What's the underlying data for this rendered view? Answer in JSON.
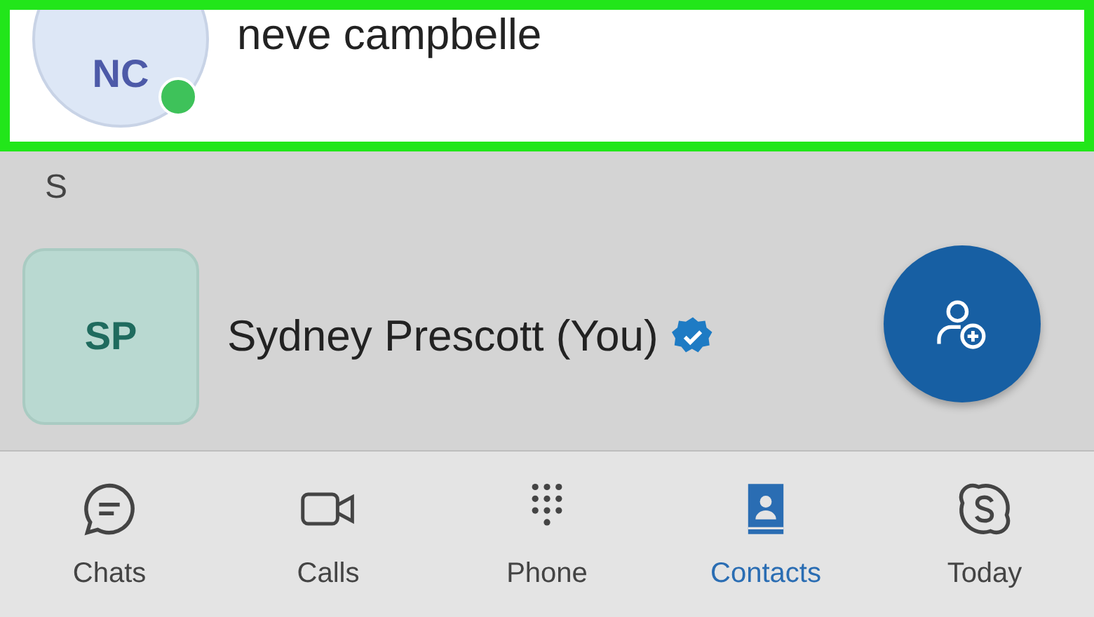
{
  "contacts_top": [
    {
      "initials": "NC",
      "name": "neve campbelle",
      "online": true,
      "highlighted": true,
      "kind": "circle",
      "verified": false
    }
  ],
  "section": {
    "letter": "S",
    "contacts": [
      {
        "initials": "SP",
        "name": "Sydney Prescott (You)",
        "online": false,
        "highlighted": false,
        "kind": "square",
        "verified": true
      }
    ]
  },
  "nav": [
    {
      "label": "Chats",
      "kind": "chat",
      "selected": false
    },
    {
      "label": "Calls",
      "kind": "video",
      "selected": false
    },
    {
      "label": "Phone",
      "kind": "dialpad",
      "selected": false
    },
    {
      "label": "Contacts",
      "kind": "contacts",
      "selected": true
    },
    {
      "label": "Today",
      "kind": "s",
      "selected": false
    }
  ]
}
